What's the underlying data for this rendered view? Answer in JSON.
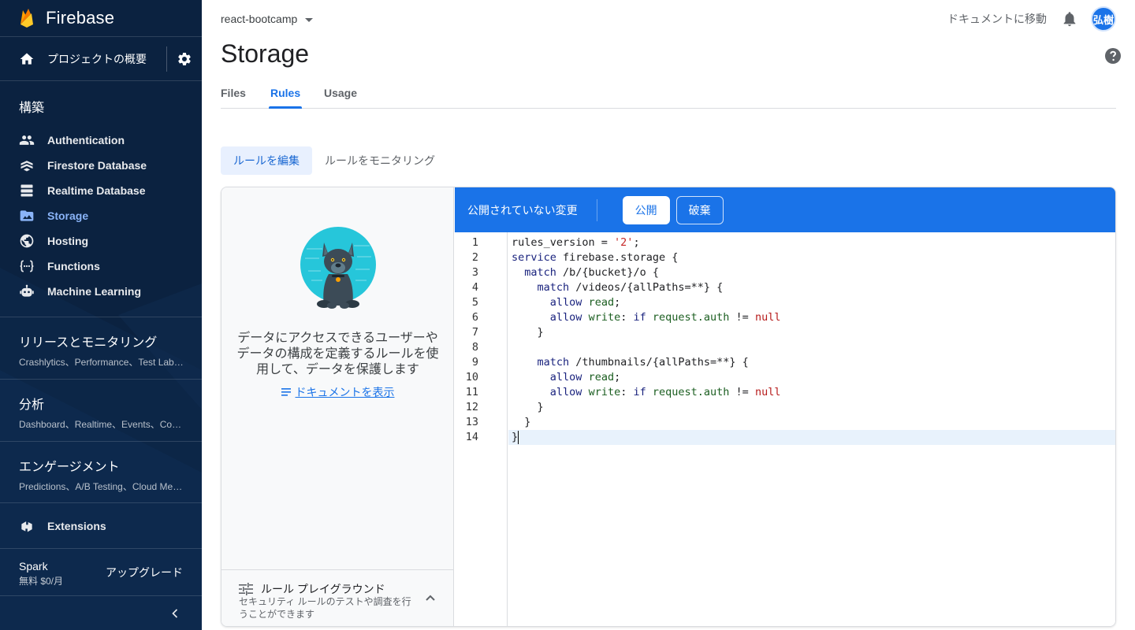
{
  "sidebar": {
    "brand": "Firebase",
    "overview_label": "プロジェクトの概要",
    "build_title": "構築",
    "build_items": [
      {
        "label": "Authentication",
        "icon": "people-icon"
      },
      {
        "label": "Firestore Database",
        "icon": "firestore-icon"
      },
      {
        "label": "Realtime Database",
        "icon": "database-icon"
      },
      {
        "label": "Storage",
        "icon": "storage-icon"
      },
      {
        "label": "Hosting",
        "icon": "globe-icon"
      },
      {
        "label": "Functions",
        "icon": "functions-icon"
      },
      {
        "label": "Machine Learning",
        "icon": "robot-icon"
      }
    ],
    "groups": [
      {
        "title": "リリースとモニタリング",
        "sub": "Crashlytics、Performance、Test Lab、App Distribution"
      },
      {
        "title": "分析",
        "sub": "Dashboard、Realtime、Events、Conversions"
      },
      {
        "title": "エンゲージメント",
        "sub": "Predictions、A/B Testing、Cloud Messaging"
      }
    ],
    "extensions_label": "Extensions",
    "plan_name": "Spark",
    "plan_price": "無料 $0/月",
    "upgrade_label": "アップグレード"
  },
  "header": {
    "project": "react-bootcamp",
    "docs_link": "ドキュメントに移動",
    "avatar_text": "弘樹"
  },
  "page": {
    "title": "Storage",
    "tabs": [
      "Files",
      "Rules",
      "Usage"
    ],
    "active_tab": "Rules",
    "subtabs": [
      "ルールを編集",
      "ルールをモニタリング"
    ]
  },
  "left_panel": {
    "info": "データにアクセスできるユーザーやデータの構成を定義するルールを使用して、データを保護します",
    "doc_link": "ドキュメントを表示",
    "playground_title": "ルール プレイグラウンド",
    "playground_desc": "セキュリティ ルールのテストや調査を行うことができます"
  },
  "editor": {
    "unsaved_label": "公開されていない変更",
    "publish_label": "公開",
    "discard_label": "破棄",
    "line_numbers": [
      "1",
      "2",
      "3",
      "4",
      "5",
      "6",
      "7",
      "8",
      "9",
      "10",
      "11",
      "12",
      "13",
      "14"
    ],
    "code_lines": [
      "rules_version = '2';",
      "service firebase.storage {",
      "  match /b/{bucket}/o {",
      "    match /videos/{allPaths=**} {",
      "      allow read;",
      "      allow write: if request.auth != null",
      "    }",
      "",
      "    match /thumbnails/{allPaths=**} {",
      "      allow read;",
      "      allow write: if request.auth != null",
      "    }",
      "  }",
      "}"
    ]
  },
  "colors": {
    "sidebar_bg": "#0b2240",
    "accent": "#1a73e8",
    "active_nav": "#8ab4f8"
  }
}
